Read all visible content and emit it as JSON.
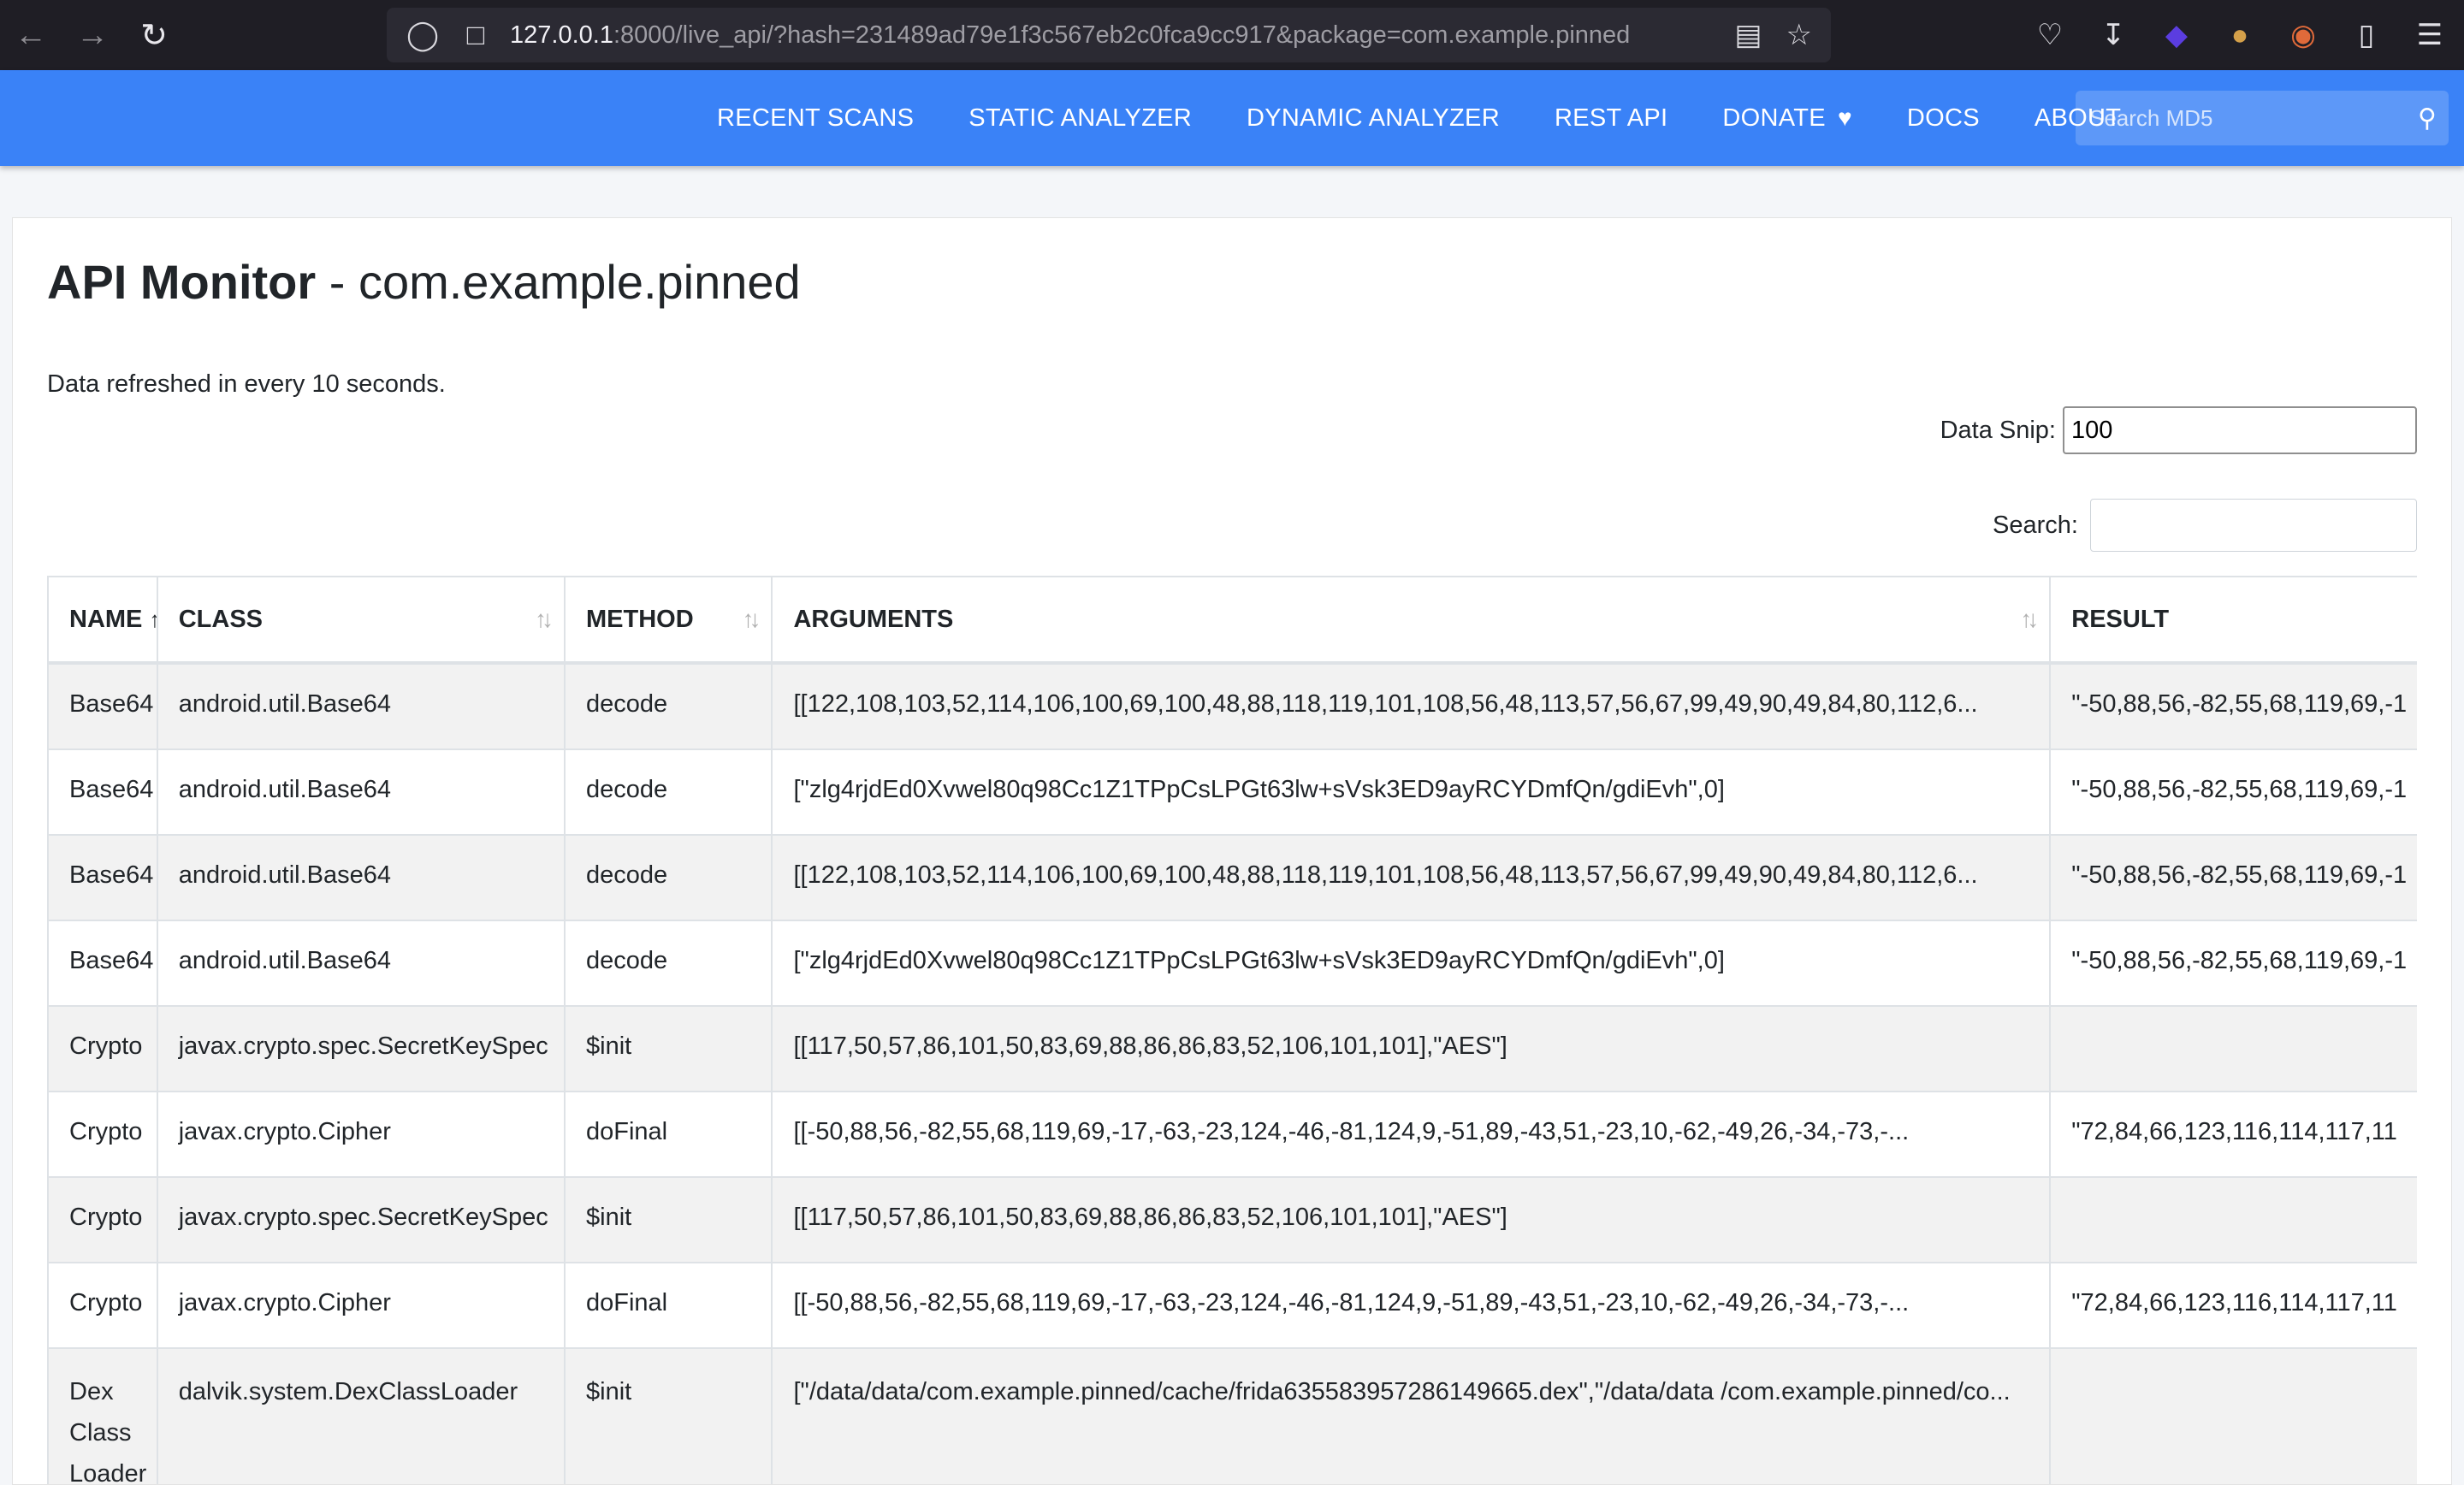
{
  "browser": {
    "url_host": "127.0.0.1",
    "url_rest": ":8000/live_api/?hash=231489ad79e1f3c567eb2c0fca9cc917&package=com.example.pinned"
  },
  "navbar": {
    "items": [
      "RECENT SCANS",
      "STATIC ANALYZER",
      "DYNAMIC ANALYZER",
      "REST API",
      "DONATE",
      "DOCS",
      "ABOUT"
    ],
    "search_placeholder": "Search MD5"
  },
  "page": {
    "title_bold": "API Monitor",
    "title_rest": " - com.example.pinned",
    "refresh_text": "Data refreshed in every 10 seconds.",
    "data_snip_label": "Data Snip:",
    "data_snip_value": "100",
    "search_label": "Search:"
  },
  "table": {
    "headers": [
      "NAME",
      "CLASS",
      "METHOD",
      "ARGUMENTS",
      "RESULT"
    ],
    "rows": [
      {
        "name": "Base64",
        "class": "android.util.Base64",
        "method": "decode",
        "args": "[[122,108,103,52,114,106,100,69,100,48,88,118,119,101,108,56,48,113,57,56,67,99,49,90,49,84,80,112,6...",
        "result": "\"-50,88,56,-82,55,68,119,69,-1"
      },
      {
        "name": "Base64",
        "class": "android.util.Base64",
        "method": "decode",
        "args": "[\"zlg4rjdEd0Xvwel80q98Cc1Z1TPpCsLPGt63lw+sVsk3ED9ayRCYDmfQn/gdiEvh\",0]",
        "result": "\"-50,88,56,-82,55,68,119,69,-1"
      },
      {
        "name": "Base64",
        "class": "android.util.Base64",
        "method": "decode",
        "args": "[[122,108,103,52,114,106,100,69,100,48,88,118,119,101,108,56,48,113,57,56,67,99,49,90,49,84,80,112,6...",
        "result": "\"-50,88,56,-82,55,68,119,69,-1"
      },
      {
        "name": "Base64",
        "class": "android.util.Base64",
        "method": "decode",
        "args": "[\"zlg4rjdEd0Xvwel80q98Cc1Z1TPpCsLPGt63lw+sVsk3ED9ayRCYDmfQn/gdiEvh\",0]",
        "result": "\"-50,88,56,-82,55,68,119,69,-1"
      },
      {
        "name": "Crypto",
        "class": "javax.crypto.spec.SecretKeySpec",
        "method": "$init",
        "args": "[[117,50,57,86,101,50,83,69,88,86,86,83,52,106,101,101],\"AES\"]",
        "result": ""
      },
      {
        "name": "Crypto",
        "class": "javax.crypto.Cipher",
        "method": "doFinal",
        "args": "[[-50,88,56,-82,55,68,119,69,-17,-63,-23,124,-46,-81,124,9,-51,89,-43,51,-23,10,-62,-49,26,-34,-73,-...",
        "result": "\"72,84,66,123,116,114,117,11"
      },
      {
        "name": "Crypto",
        "class": "javax.crypto.spec.SecretKeySpec",
        "method": "$init",
        "args": "[[117,50,57,86,101,50,83,69,88,86,86,83,52,106,101,101],\"AES\"]",
        "result": ""
      },
      {
        "name": "Crypto",
        "class": "javax.crypto.Cipher",
        "method": "doFinal",
        "args": "[[-50,88,56,-82,55,68,119,69,-17,-63,-23,124,-46,-81,124,9,-51,89,-43,51,-23,10,-62,-49,26,-34,-73,-...",
        "result": "\"72,84,66,123,116,114,117,11"
      },
      {
        "name": "Dex Class Loader",
        "class": "dalvik.system.DexClassLoader",
        "method": "$init",
        "args": "[\"/data/data/com.example.pinned/cache/frida635583957286149665.dex\",\"/data/data /com.example.pinned/co...",
        "result": ""
      }
    ]
  },
  "colors": {
    "navbar": "#3a82f7",
    "chrome": "#1f1e25"
  }
}
